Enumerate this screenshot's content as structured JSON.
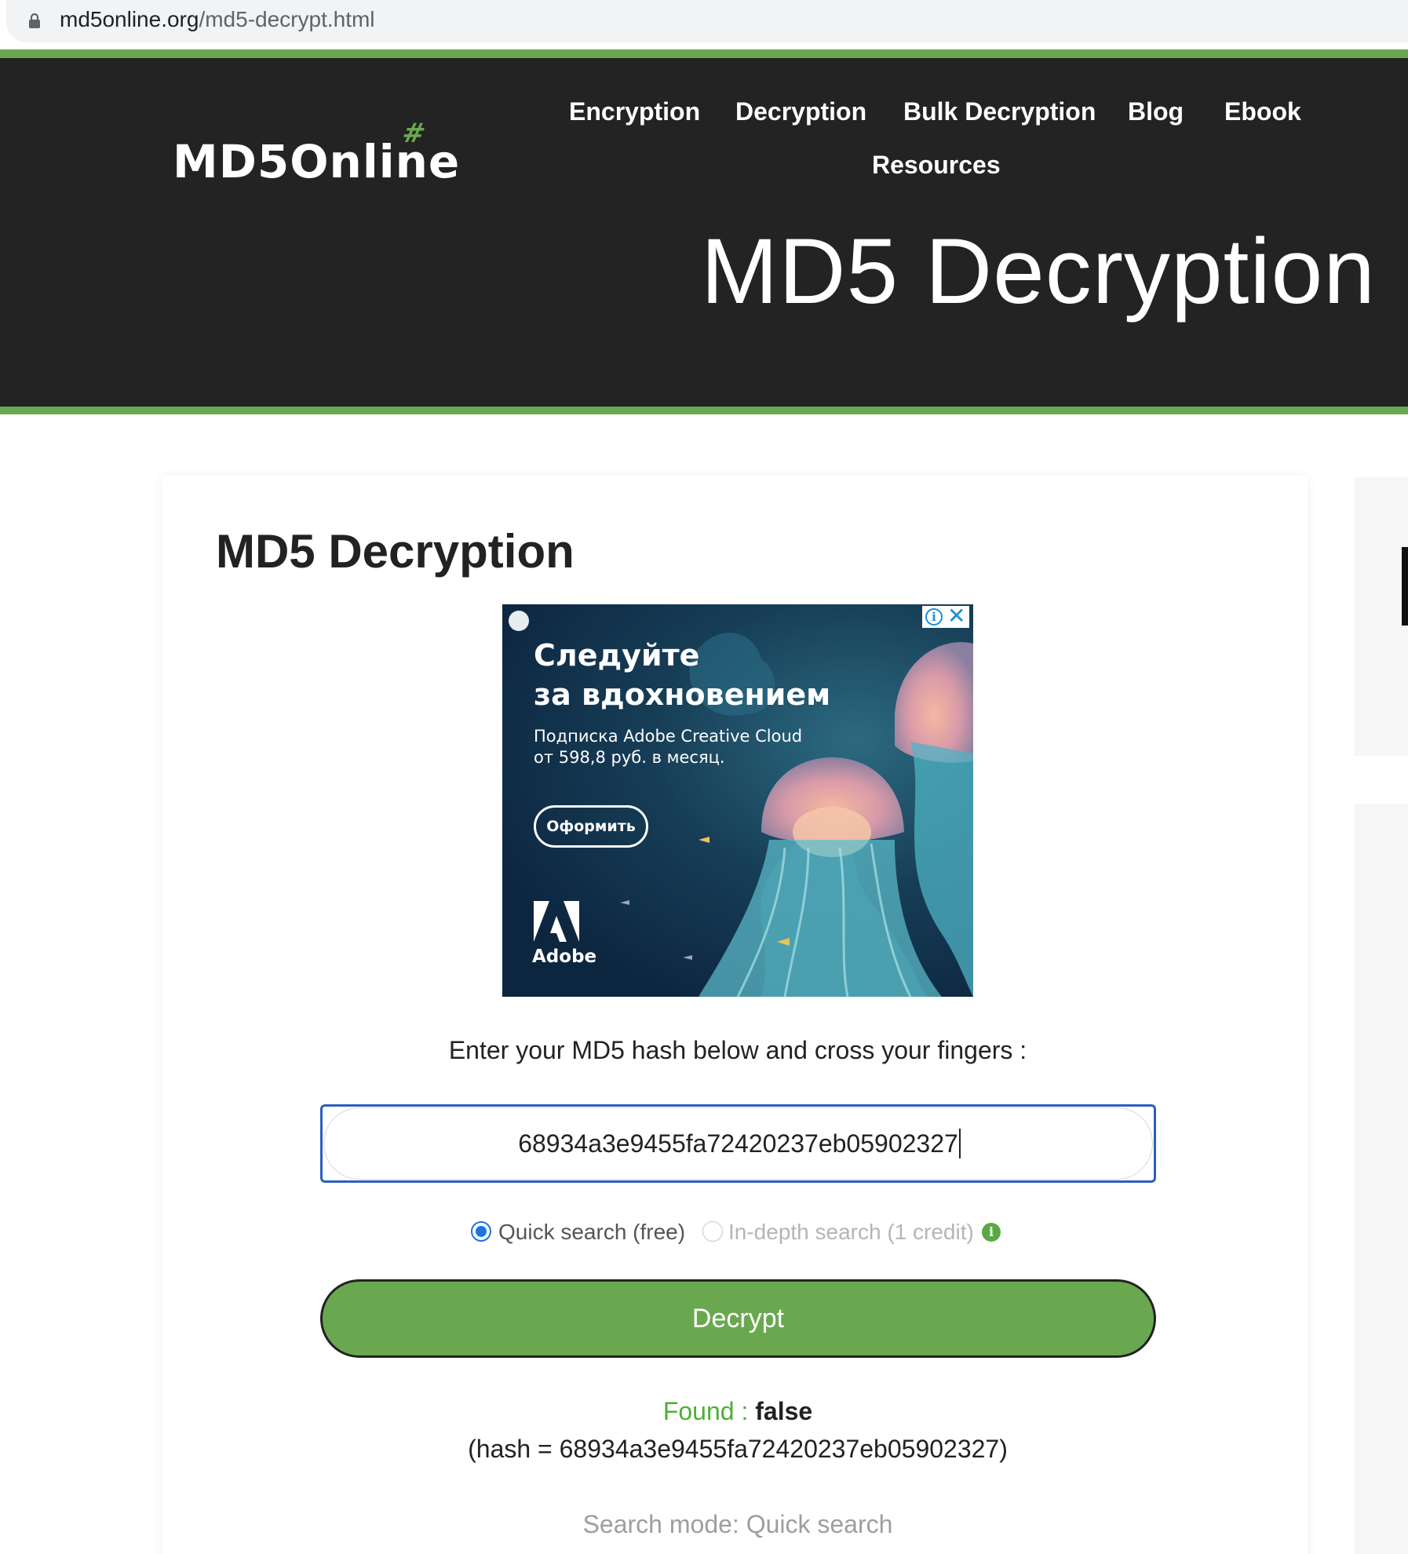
{
  "browser": {
    "url_domain": "md5online.org",
    "url_path": "/md5-decrypt.html"
  },
  "header": {
    "logo_text": "MD5Online",
    "logo_hash": "#",
    "nav": [
      "Encryption",
      "Decryption",
      "Bulk Decryption",
      "Blog",
      "Ebook",
      "Resources"
    ],
    "hero_title": "MD5 Decryption"
  },
  "main": {
    "title": "MD5 Decryption",
    "ad": {
      "headline_1": "Следуйте",
      "headline_2": "за вдохновением",
      "sub_1": "Подписка Adobe Creative Cloud",
      "sub_2": "от 598,8 руб. в месяц.",
      "button": "Оформить",
      "brand": "Adobe",
      "close": "✕",
      "info": "i"
    },
    "prompt": "Enter your MD5 hash below and cross your fingers :",
    "hash_value": "68934a3e9455fa72420237eb05902327",
    "search_modes": {
      "quick": "Quick search (free)",
      "indepth": "In-depth search (1 credit)",
      "selected": "quick"
    },
    "decrypt_button": "Decrypt",
    "result": {
      "found_label": "Found :",
      "found_value": "false",
      "hash_line": "(hash = 68934a3e9455fa72420237eb05902327)",
      "mode_line": "Search mode: Quick search"
    }
  },
  "colors": {
    "header_bg": "#232323",
    "accent_green": "#6aa84f",
    "found_green": "#4caf35",
    "input_border": "#2a5fbf"
  }
}
